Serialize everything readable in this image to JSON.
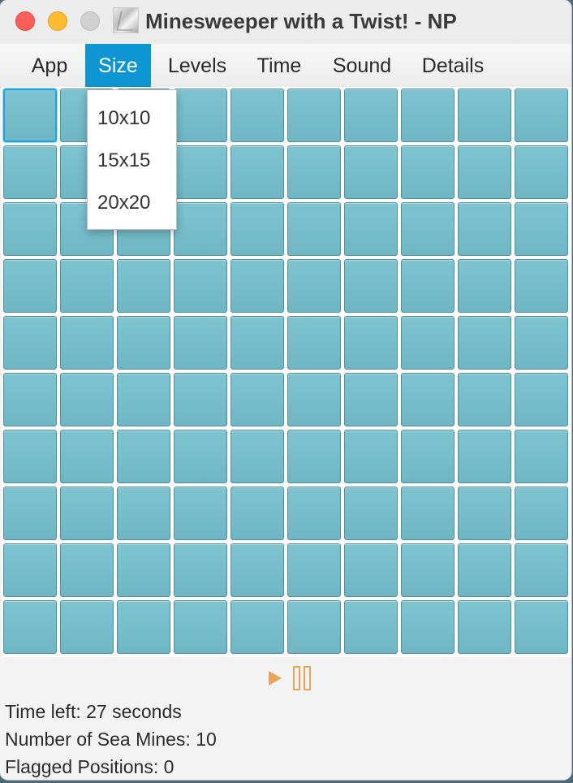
{
  "window": {
    "title": "Minesweeper with a Twist! - NP",
    "colors": {
      "close": "#ff5f57",
      "minimize": "#febc2e",
      "maximize": "#d1d1d1"
    }
  },
  "menu": [
    {
      "id": "app",
      "label": "App",
      "active": false
    },
    {
      "id": "size",
      "label": "Size",
      "active": true
    },
    {
      "id": "levels",
      "label": "Levels",
      "active": false
    },
    {
      "id": "time",
      "label": "Time",
      "active": false
    },
    {
      "id": "sound",
      "label": "Sound",
      "active": false
    },
    {
      "id": "details",
      "label": "Details",
      "active": false
    }
  ],
  "size_menu": {
    "options": [
      "10x10",
      "15x15",
      "20x20"
    ]
  },
  "board": {
    "rows": 10,
    "cols": 10,
    "focused_cell": [
      0,
      0
    ],
    "cell_color": "#78bdca"
  },
  "controls": {
    "play_icon": "play-icon",
    "pause_icon": "pause-icon",
    "icon_color": "#e8a55a"
  },
  "status": {
    "time_left": "Time left: 27 seconds",
    "sea_mines": "Number of Sea Mines: 10",
    "flagged": "Flagged Positions: 0"
  },
  "accent_color": "#0d96d3"
}
